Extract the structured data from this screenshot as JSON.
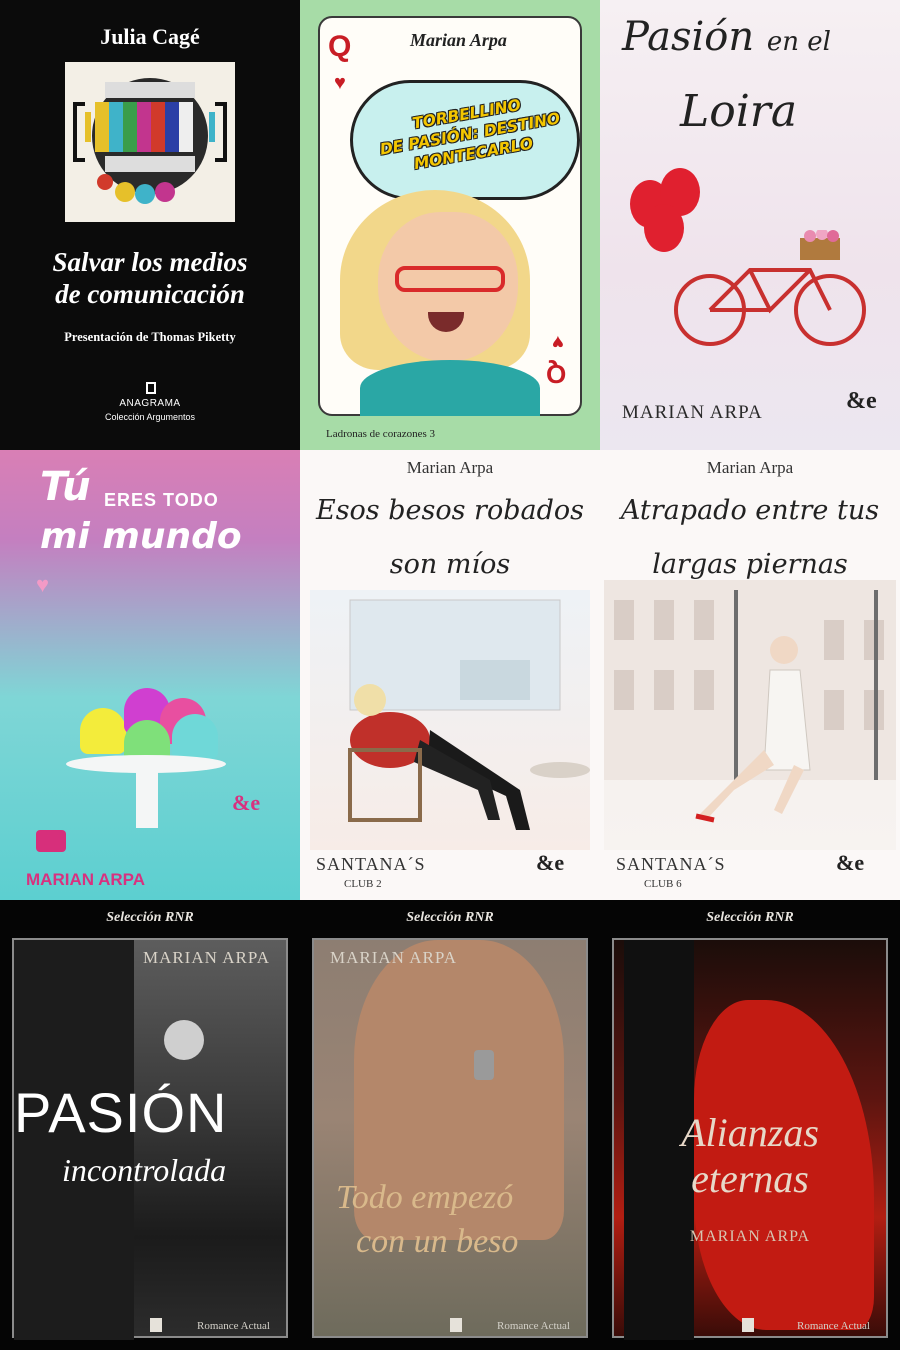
{
  "covers": {
    "c1": {
      "author": "Julia Cagé",
      "title_line1": "Salvar los medios",
      "title_line2": "de comunicación",
      "subtitle": "Presentación de Thomas Piketty",
      "publisher": "ANAGRAMA",
      "collection": "Colección Argumentos"
    },
    "c2": {
      "author": "Marian Arpa",
      "title_line1": "TORBELLINO",
      "title_line2": "DE PASIÓN: DESTINO",
      "title_line3": "MONTECARLO",
      "card_letter": "Q",
      "series": "Ladronas de corazones 3"
    },
    "c3": {
      "title_line1": "Pasión",
      "title_mid": "en el",
      "title_line2": "Loira",
      "author": "MARIAN ARPA"
    },
    "c4": {
      "title_tu": "Tú",
      "title_mid": "ERES TODO",
      "title_line2": "mi mundo",
      "author": "MARIAN ARPA"
    },
    "c5": {
      "author": "Marian Arpa",
      "title_line1": "Esos besos robados",
      "title_line2": "son míos",
      "club": "SANTANA´S",
      "club_number": "CLUB 2"
    },
    "c6": {
      "author": "Marian Arpa",
      "title_line1": "Atrapado entre tus",
      "title_line2": "largas piernas",
      "club": "SANTANA´S",
      "club_number": "CLUB 6"
    },
    "c7": {
      "label": "Selección RNR",
      "author": "MARIAN ARPA",
      "title_line1": "PASIÓN",
      "title_line2": "incontrolada",
      "imprint": "Romance Actual"
    },
    "c8": {
      "label": "Selección RNR",
      "author": "MARIAN ARPA",
      "title_line1": "Todo empezó",
      "title_line2": "con un beso",
      "imprint": "Romance Actual"
    },
    "c9": {
      "label": "Selección RNR",
      "author": "MARIAN ARPA",
      "title_line1": "Alianzas",
      "title_line2": "eternas",
      "imprint": "Romance Actual"
    }
  },
  "icons": {
    "publisher_mark": "ee-logo",
    "heart": "heart-icon"
  }
}
